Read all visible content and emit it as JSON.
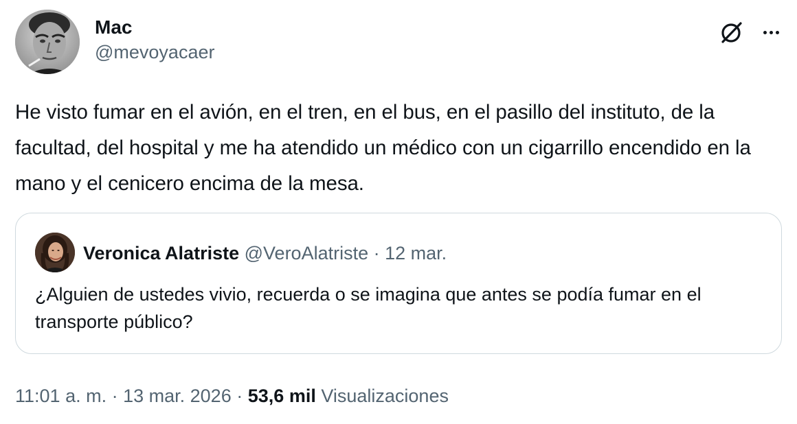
{
  "tweet": {
    "author": {
      "display_name": "Mac",
      "handle": "@mevoyacaer"
    },
    "text": "He visto fumar en el avión, en el tren, en el bus, en el pasillo del instituto, de la facultad, del hospital y me ha atendido un médico con un cigarrillo encendido en la mano y el cenicero encima de la mesa.",
    "icons": {
      "grok": "grok-icon",
      "more": "more-options-icon"
    },
    "quoted": {
      "display_name": "Veronica Alatriste",
      "handle": "@VeroAlatriste",
      "separator": "·",
      "date": "12 mar.",
      "text": "¿Alguien de ustedes vivio, recuerda o se imagina que antes se podía fumar en el transporte público?"
    },
    "meta": {
      "time": "11:01 a. m.",
      "separator1": "·",
      "date": "13 mar. 2026",
      "separator2": "·",
      "views_count": "53,6 mil",
      "views_label": "Visualizaciones"
    }
  },
  "colors": {
    "text_primary": "#0f1419",
    "text_secondary": "#536471",
    "border": "#cfd9de"
  }
}
